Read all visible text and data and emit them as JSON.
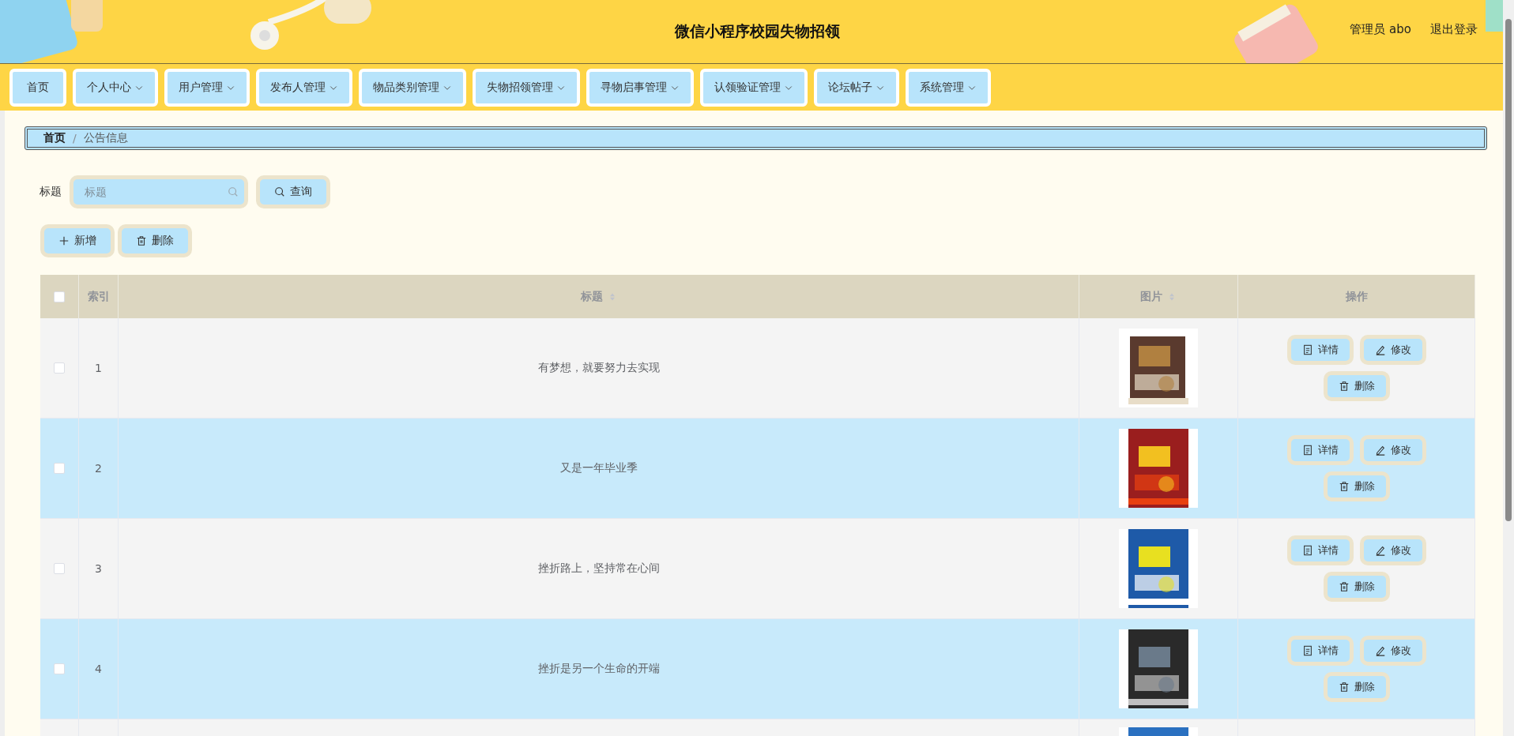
{
  "header": {
    "title": "微信小程序校园失物招领",
    "user": "管理员 abo",
    "logout": "退出登录"
  },
  "nav": [
    {
      "label": "首页",
      "has_menu": false
    },
    {
      "label": "个人中心",
      "has_menu": true
    },
    {
      "label": "用户管理",
      "has_menu": true
    },
    {
      "label": "发布人管理",
      "has_menu": true
    },
    {
      "label": "物品类别管理",
      "has_menu": true
    },
    {
      "label": "失物招领管理",
      "has_menu": true
    },
    {
      "label": "寻物启事管理",
      "has_menu": true
    },
    {
      "label": "认领验证管理",
      "has_menu": true
    },
    {
      "label": "论坛帖子",
      "has_menu": true
    },
    {
      "label": "系统管理",
      "has_menu": true
    }
  ],
  "breadcrumb": {
    "separator": "/",
    "items": [
      {
        "label": "首页",
        "current": false
      },
      {
        "label": "公告信息",
        "current": true
      }
    ]
  },
  "search": {
    "label": "标题",
    "placeholder": "标题",
    "button": "查询"
  },
  "actions": [
    {
      "kind": "add",
      "label": "新增"
    },
    {
      "kind": "delete",
      "label": "删除"
    }
  ],
  "table": {
    "columns": [
      {
        "kind": "checkbox",
        "checked": false
      },
      {
        "kind": "text",
        "label": "索引",
        "sortable": false
      },
      {
        "kind": "text",
        "label": "标题",
        "sortable": true
      },
      {
        "kind": "text",
        "label": "图片",
        "sortable": true
      },
      {
        "kind": "text",
        "label": "操作",
        "sortable": false
      }
    ],
    "rows": [
      {
        "selected": false,
        "index": "1",
        "title": "有梦想，就要努力去实现",
        "image": {
          "kind": "picture"
        },
        "actions": [
          {
            "kind": "detail",
            "label": "详情"
          },
          {
            "kind": "edit",
            "label": "修改"
          },
          {
            "kind": "delete",
            "label": "删除"
          }
        ]
      },
      {
        "selected": false,
        "index": "2",
        "title": "又是一年毕业季",
        "image": {
          "kind": "picture"
        },
        "actions": [
          {
            "kind": "detail",
            "label": "详情"
          },
          {
            "kind": "edit",
            "label": "修改"
          },
          {
            "kind": "delete",
            "label": "删除"
          }
        ]
      },
      {
        "selected": false,
        "index": "3",
        "title": "挫折路上，坚持常在心间",
        "image": {
          "kind": "picture"
        },
        "actions": [
          {
            "kind": "detail",
            "label": "详情"
          },
          {
            "kind": "edit",
            "label": "修改"
          },
          {
            "kind": "delete",
            "label": "删除"
          }
        ]
      },
      {
        "selected": false,
        "index": "4",
        "title": "挫折是另一个生命的开端",
        "image": {
          "kind": "picture"
        },
        "actions": [
          {
            "kind": "detail",
            "label": "详情"
          },
          {
            "kind": "edit",
            "label": "修改"
          },
          {
            "kind": "delete",
            "label": "删除"
          }
        ]
      },
      {
        "image": {
          "kind": "picture"
        }
      }
    ]
  }
}
